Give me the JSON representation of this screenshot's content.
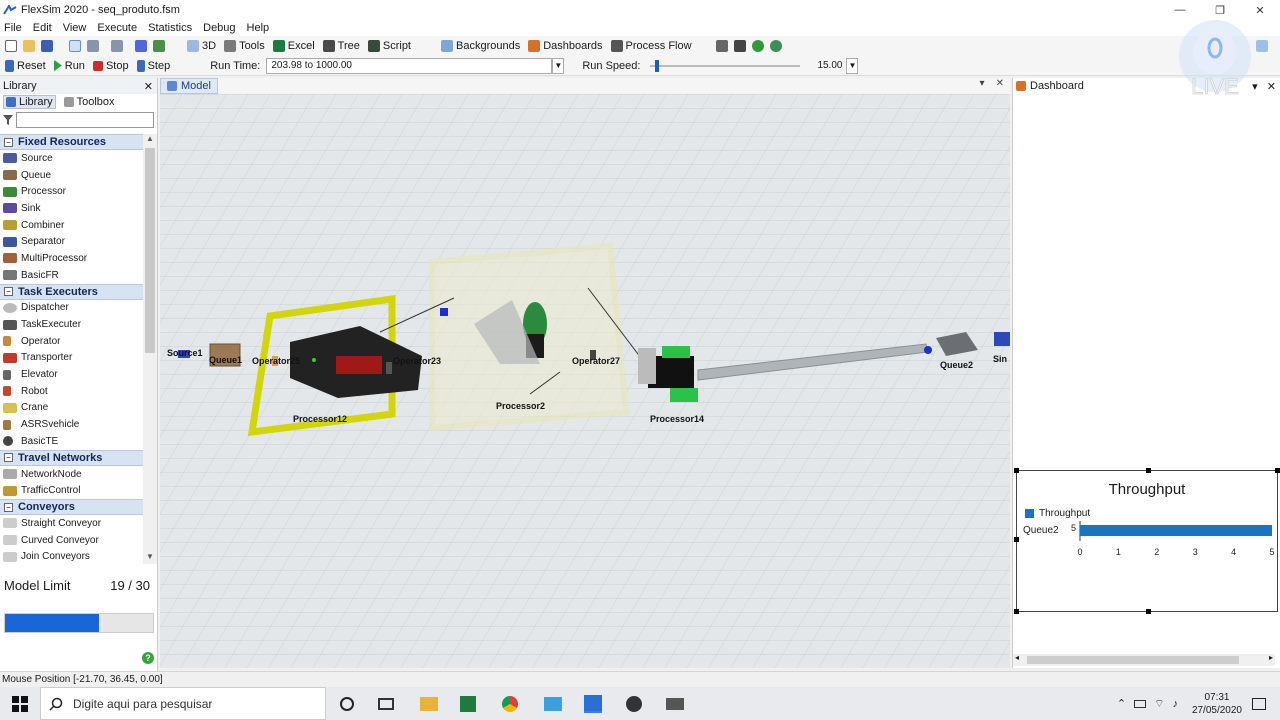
{
  "window": {
    "title": "FlexSim 2020 - seq_produto.fsm",
    "minimize_glyph": "—",
    "restore_glyph": "❐",
    "close_glyph": "✕"
  },
  "menu": [
    "File",
    "Edit",
    "View",
    "Execute",
    "Statistics",
    "Debug",
    "Help"
  ],
  "toolbar": {
    "view3d": "3D",
    "tools": "Tools",
    "excel": "Excel",
    "tree": "Tree",
    "script": "Script",
    "backgrounds": "Backgrounds",
    "dashboards": "Dashboards",
    "process_flow": "Process Flow"
  },
  "run_controls": {
    "reset": "Reset",
    "run": "Run",
    "stop": "Stop",
    "step": "Step",
    "run_time_label": "Run Time:",
    "run_time_value": "203.98 to 1000.00",
    "run_speed_label": "Run Speed:",
    "run_speed_value": "15.00",
    "run_speed_position": 0.03
  },
  "library": {
    "title": "Library",
    "close": "✕",
    "tabs": [
      "Library",
      "Toolbox"
    ],
    "categories": [
      {
        "name": "Fixed Resources",
        "items": [
          "Source",
          "Queue",
          "Processor",
          "Sink",
          "Combiner",
          "Separator",
          "MultiProcessor",
          "BasicFR"
        ]
      },
      {
        "name": "Task Executers",
        "items": [
          "Dispatcher",
          "TaskExecuter",
          "Operator",
          "Transporter",
          "Elevator",
          "Robot",
          "Crane",
          "ASRSvehicle",
          "BasicTE"
        ]
      },
      {
        "name": "Travel Networks",
        "items": [
          "NetworkNode",
          "TrafficControl"
        ]
      },
      {
        "name": "Conveyors",
        "items": [
          "Straight Conveyor",
          "Curved Conveyor",
          "Join Conveyors"
        ]
      }
    ],
    "collapse_glyph": "−"
  },
  "model_limit": {
    "label": "Model Limit",
    "value": "19 / 30",
    "fraction": 0.633
  },
  "model_tab": {
    "title": "Model",
    "objects": [
      "Source1",
      "Queue1",
      "Operator25",
      "Operator23",
      "Processor12",
      "Processor2",
      "Operator27",
      "Processor14",
      "Queue2",
      "Sin"
    ]
  },
  "dashboard": {
    "title": "Dashboard",
    "chart_data": {
      "type": "bar",
      "title": "Throughput",
      "categories": [
        "Queue2"
      ],
      "series": [
        {
          "name": "Throughput",
          "values": [
            5
          ]
        }
      ],
      "data_labels": [
        "5"
      ],
      "xlim": [
        0,
        5
      ],
      "xticks": [
        "0",
        "1",
        "2",
        "3",
        "4",
        "5"
      ],
      "orientation": "horizontal",
      "colors": [
        "#1e73be"
      ]
    }
  },
  "status": {
    "mouse_position": "Mouse Position [-21.70, 36.45, 0.00]"
  },
  "taskbar": {
    "search_placeholder": "Digite aqui para pesquisar",
    "time": "07:31",
    "date": "27/05/2020"
  },
  "overlay": {
    "live_text": "LIVE"
  },
  "colors": {
    "accent": "#1a66d6",
    "chart_bar": "#1e73be",
    "category_header": "#d7e2f3"
  }
}
